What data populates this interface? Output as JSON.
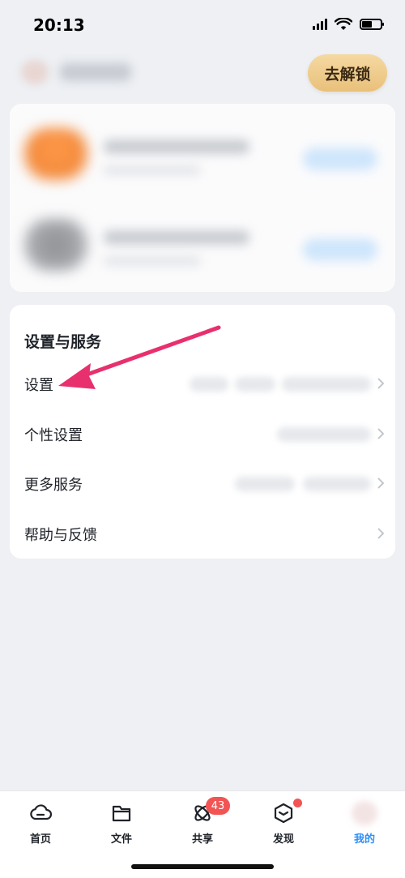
{
  "status_bar": {
    "time": "20:13"
  },
  "header": {
    "unlock_button": "去解锁"
  },
  "settings_section": {
    "title": "设置与服务",
    "items": [
      {
        "label": "设置"
      },
      {
        "label": "个性设置"
      },
      {
        "label": "更多服务"
      },
      {
        "label": "帮助与反馈"
      }
    ]
  },
  "tab_bar": {
    "tabs": [
      {
        "label": "首页",
        "icon": "cloud-icon"
      },
      {
        "label": "文件",
        "icon": "folder-icon"
      },
      {
        "label": "共享",
        "icon": "atom-icon",
        "badge": "43"
      },
      {
        "label": "发现",
        "icon": "discover-box-icon"
      },
      {
        "label": "我的",
        "icon": "avatar"
      }
    ]
  },
  "colors": {
    "accent": "#2f8ff5",
    "badge": "#f25454",
    "unlock_gold": "#e9c07a",
    "arrow": "#e8306e"
  }
}
